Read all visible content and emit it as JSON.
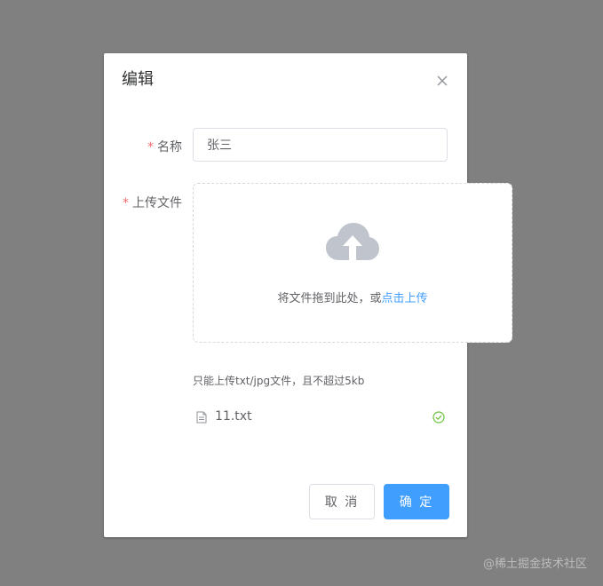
{
  "dialog": {
    "title": "编辑"
  },
  "form": {
    "name": {
      "required_mark": "*",
      "label": "名称",
      "value": "张三"
    },
    "upload": {
      "required_mark": "*",
      "label": "上传文件",
      "drag_text": "将文件拖到此处，或",
      "click_text": "点击上传",
      "tip": "只能上传txt/jpg文件，且不超过5kb",
      "files": [
        {
          "name": "11.txt",
          "status": "success"
        }
      ]
    }
  },
  "footer": {
    "cancel_label": "取 消",
    "confirm_label": "确 定"
  },
  "watermark": "@稀土掘金技术社区",
  "colors": {
    "primary": "#409eff",
    "required": "#f56c6c",
    "success": "#67c23a",
    "overlay": "#808080"
  },
  "icons": {
    "close": "close-icon",
    "upload": "upload-cloud-icon",
    "file": "document-icon",
    "success": "circle-check-icon"
  }
}
